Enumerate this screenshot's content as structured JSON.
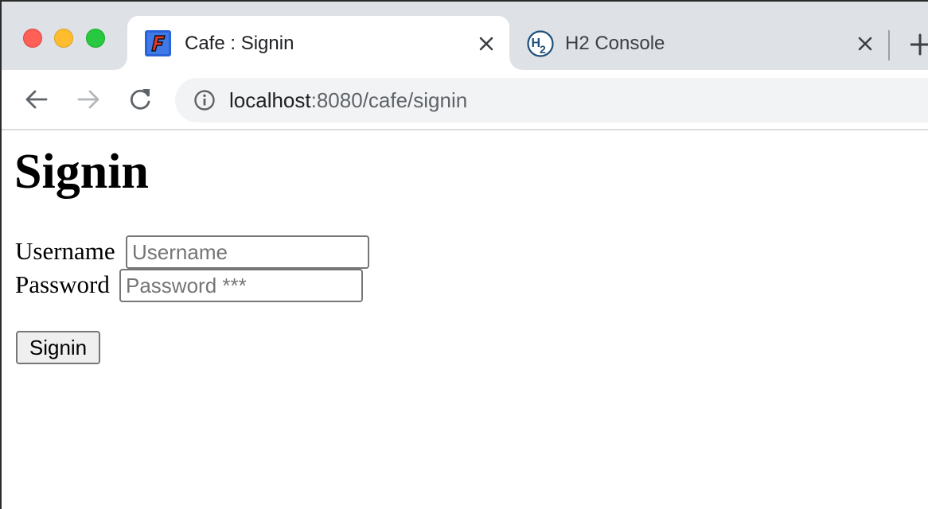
{
  "browser": {
    "tabs": [
      {
        "title": "Cafe : Signin",
        "active": true,
        "favicon": "cafe-logo-icon"
      },
      {
        "title": "H2 Console",
        "active": false,
        "favicon": "h2-logo-icon"
      }
    ],
    "address_bar": {
      "host": "localhost",
      "path": ":8080/cafe/signin"
    }
  },
  "page": {
    "title": "Signin",
    "form": {
      "username_label": "Username",
      "username_placeholder": "Username",
      "password_label": "Password",
      "password_placeholder": "Password ***",
      "submit_label": "Signin"
    }
  },
  "colors": {
    "tabstrip_bg": "#dee1e6",
    "omnibox_bg": "#f1f3f4",
    "close_red": "#fe5f57",
    "minimize_yellow": "#febc2e",
    "zoom_green": "#28c840"
  }
}
